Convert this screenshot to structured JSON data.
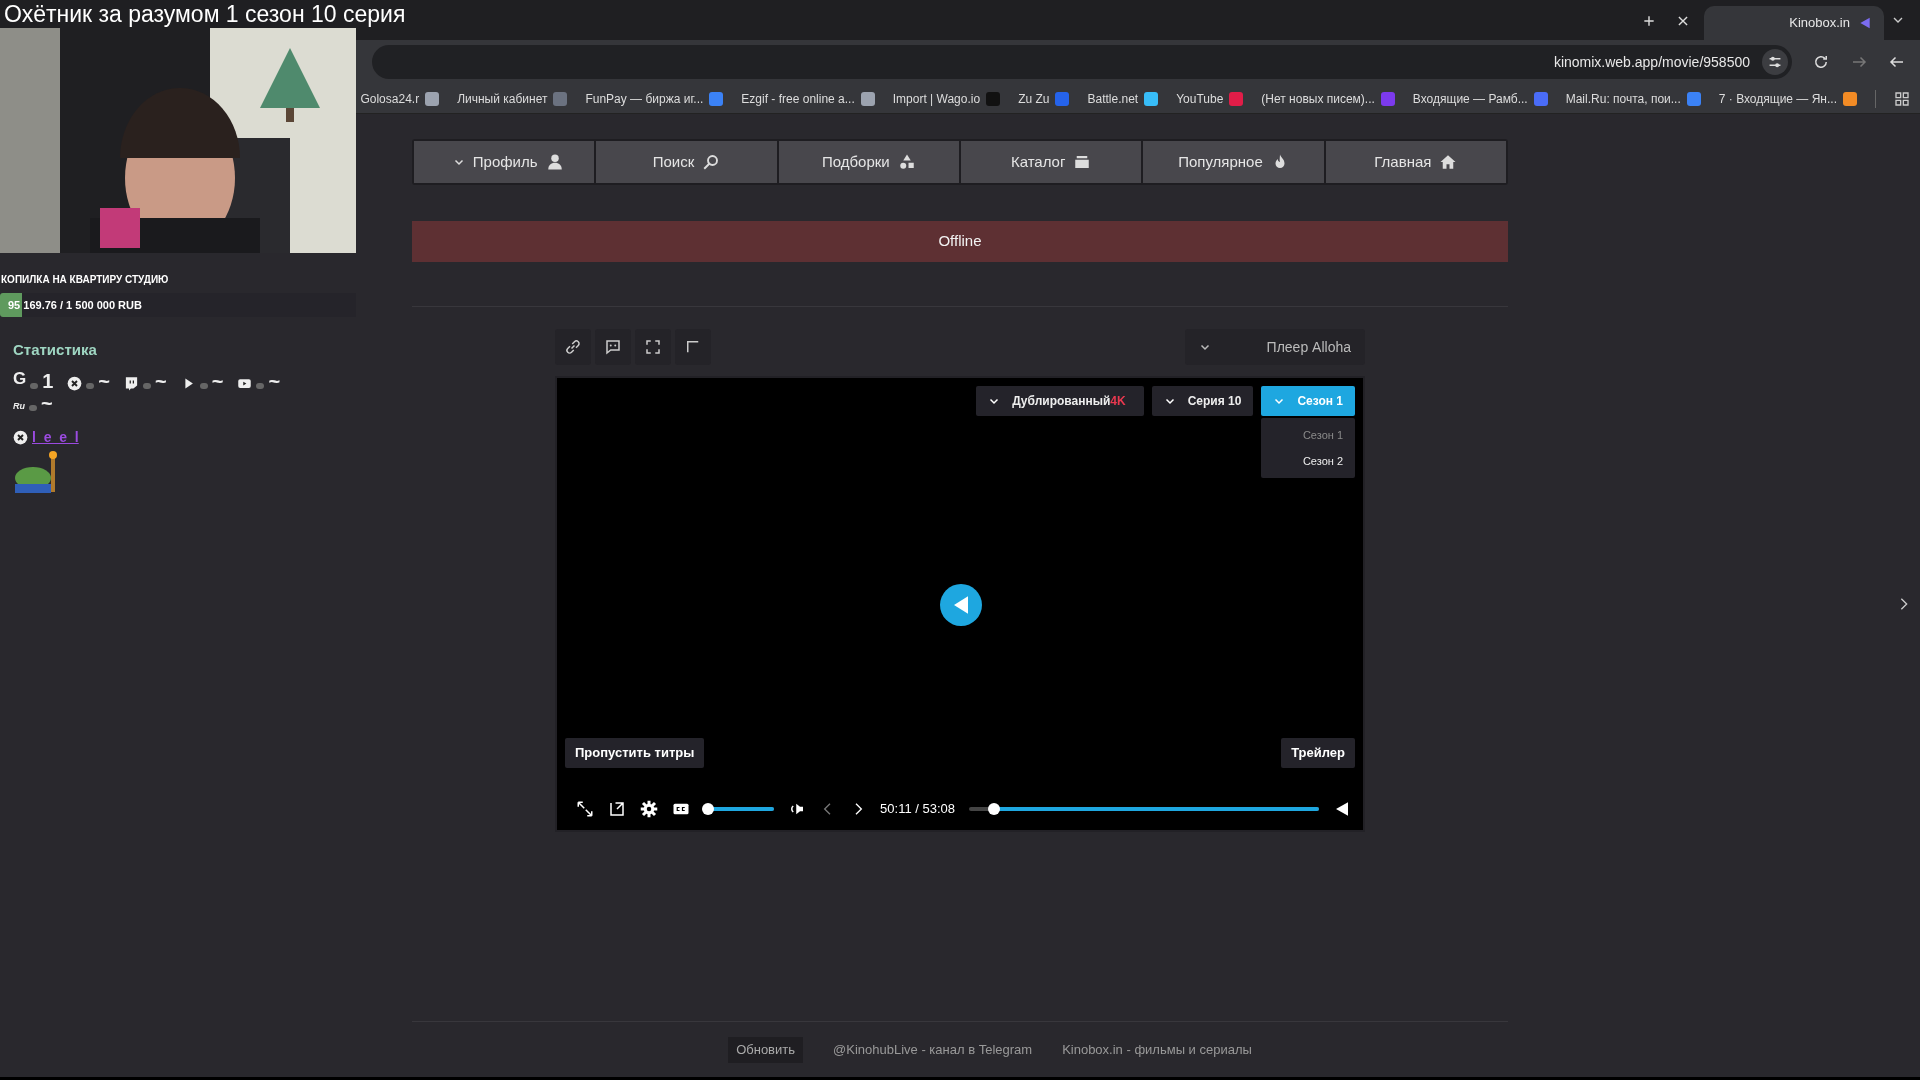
{
  "stream_title": "Охётник за разумом 1 сезон 10 серия",
  "browser": {
    "tabs": [
      {
        "label": "Kinobox.in",
        "selected": true
      }
    ],
    "url": "kinomix.web.app/movie/958500",
    "bookmarks": [
      {
        "label": "Golosa24.r",
        "color": "#9ca3af"
      },
      {
        "label": "Личный кабинет",
        "color": "#6b7280"
      },
      {
        "label": "FunPay — биржа иг...",
        "color": "#3b82f6"
      },
      {
        "label": "Ezgif - free online a...",
        "color": "#9ca3af"
      },
      {
        "label": "Import | Wago.io",
        "color": "#111111"
      },
      {
        "label": "Zu Zu",
        "color": "#2563eb"
      },
      {
        "label": "Battle.net",
        "color": "#38bdf8"
      },
      {
        "label": "YouTube",
        "color": "#e11d48"
      },
      {
        "label": "(Нет новых писем)...",
        "color": "#7c3aed"
      },
      {
        "label": "Входящие — Рамб...",
        "color": "#4a6cf7"
      },
      {
        "label": "Mail.Ru: почта, пои...",
        "color": "#3b82f6"
      },
      {
        "label": "7 · Входящие — Ян...",
        "color": "#f28b25"
      }
    ]
  },
  "overlay": {
    "goal": {
      "title": "КОПИЛКА НА КВАРТИРУ СТУДИЮ",
      "amount": "95 169.76 / 1 500 000 RUB",
      "level": 0.063
    },
    "stats": {
      "title": "Статистика",
      "items": [
        {
          "kind": "letter",
          "label": "G",
          "value": "1"
        },
        {
          "kind": "x",
          "value": "~"
        },
        {
          "kind": "twitch",
          "value": "~"
        },
        {
          "kind": "play",
          "value": "~"
        },
        {
          "kind": "video",
          "value": "~"
        },
        {
          "kind": "letter",
          "label": "Ru",
          "value": "~"
        }
      ]
    },
    "user": "l_e_e_l"
  },
  "nav": [
    {
      "label": "Профиль",
      "dropdown": true
    },
    {
      "label": "Поиск",
      "dropdown": false
    },
    {
      "label": "Подборки",
      "dropdown": false
    },
    {
      "label": "Каталог",
      "dropdown": false
    },
    {
      "label": "Популярное",
      "dropdown": false
    },
    {
      "label": "Главная",
      "dropdown": false
    }
  ],
  "banner": "Offline",
  "player_source": "Плеер Alloha",
  "player": {
    "selectors": [
      {
        "label": "Дублированный",
        "badge": "4K",
        "open": false
      },
      {
        "label": "Серия 10",
        "open": false
      },
      {
        "label": "Сезон 1",
        "open": true,
        "options": [
          {
            "label": "Сезон 1",
            "selected": true
          },
          {
            "label": "Сезон 2",
            "selected": false
          }
        ]
      }
    ],
    "trailer": "Трейлер",
    "skip": "Пропустить титры",
    "time": "50:11 / 53:08"
  },
  "footer": {
    "links": [
      "@KinohubLive - канал в Telegram",
      "Kinobox.in - фильмы и сериалы"
    ],
    "button": "Обновить"
  }
}
